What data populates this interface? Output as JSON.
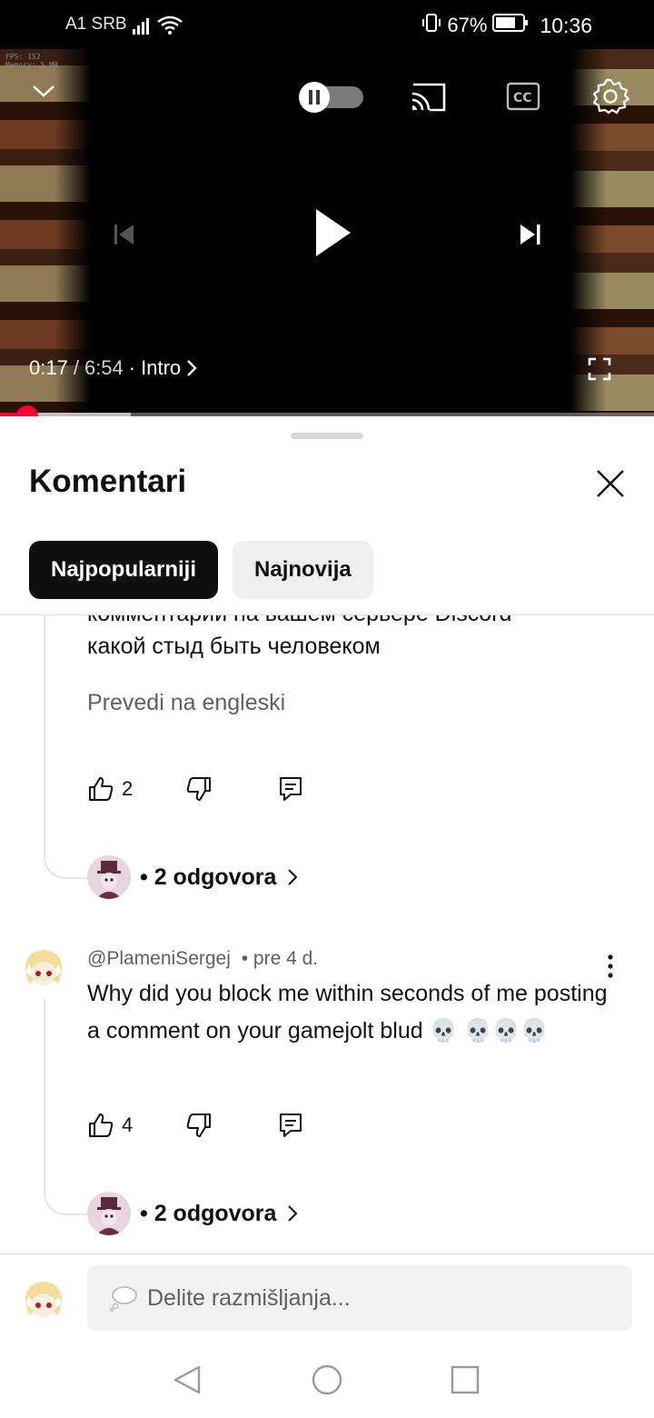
{
  "status_bar": {
    "carrier": "A1 SRB",
    "battery": "67%",
    "time": "10:36"
  },
  "player": {
    "debug_overlay": [
      "FPS: 152",
      "Memory: 5 MB"
    ],
    "current_time": "0:17",
    "separator": "/",
    "duration": "6:54",
    "chapter_sep": "·",
    "chapter": "Intro",
    "progress": 0.041
  },
  "comments_sheet": {
    "title": "Komentari",
    "sort_chips": [
      {
        "label": "Najpopularniji",
        "active": true
      },
      {
        "label": "Najnovija",
        "active": false
      }
    ]
  },
  "comments": [
    {
      "partial_first_line": "комментарии на вашем сервере Discord",
      "text": "какой стыд быть человеком",
      "translate": "Prevedi na engleski",
      "likes": "2",
      "replies": "• 2 odgovora"
    },
    {
      "author": "@PlameniSergej",
      "time": "• pre 4 d.",
      "text": "Why did you block me within seconds of me posting a comment on your gamejolt blud 💀 💀💀💀",
      "likes": "4",
      "replies": "• 2 odgovora"
    }
  ],
  "input": {
    "placeholder": "Delite razmišljanja..."
  }
}
